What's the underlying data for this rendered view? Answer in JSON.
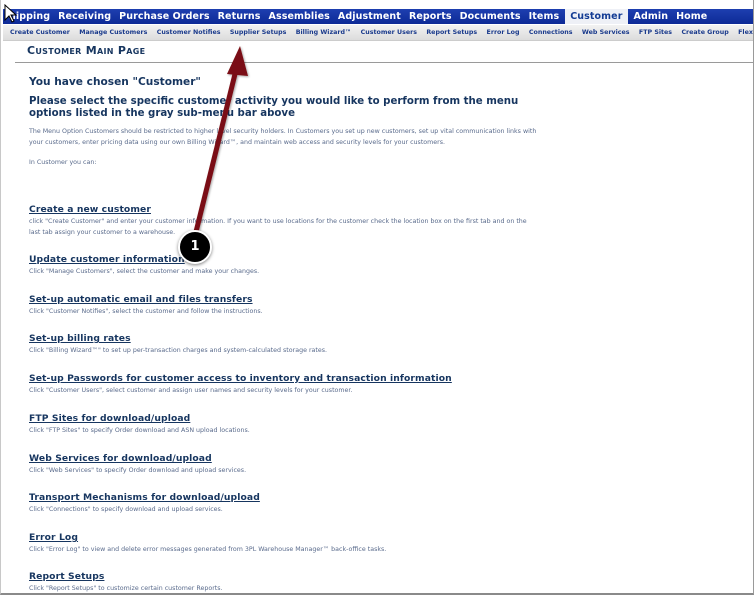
{
  "top_nav": {
    "items": [
      {
        "label": "hipping"
      },
      {
        "label": "Receiving"
      },
      {
        "label": "Purchase Orders"
      },
      {
        "label": "Returns"
      },
      {
        "label": "Assemblies"
      },
      {
        "label": "Adjustment"
      },
      {
        "label": "Reports"
      },
      {
        "label": "Documents"
      },
      {
        "label": "Items"
      },
      {
        "label": "Customer",
        "active": true
      },
      {
        "label": "Admin"
      },
      {
        "label": "Home"
      }
    ]
  },
  "sub_nav": {
    "items": [
      {
        "label": "Create Customer"
      },
      {
        "label": "Manage Customers"
      },
      {
        "label": "Customer Notifies"
      },
      {
        "label": "Supplier Setups"
      },
      {
        "label": "Billing Wizard™"
      },
      {
        "label": "Customer Users"
      },
      {
        "label": "Report Setups"
      },
      {
        "label": "Error Log"
      },
      {
        "label": "Connections"
      },
      {
        "label": "Web Services"
      },
      {
        "label": "FTP Sites"
      },
      {
        "label": "Create Group"
      },
      {
        "label": "Flex Fields"
      }
    ]
  },
  "page": {
    "title": "Customer Main Page",
    "chosen_heading": "You have chosen \"Customer\"",
    "select_heading": "Please select the specific customer activity you would like to perform from the menu options listed in the gray sub-menu bar above",
    "intro": "The Menu Option Customers should be restricted to higher level security holders. In Customers you set up new customers, set up vital communication links with your customers, enter pricing data using our own Billing Wizard™, and maintain web access and security levels for your customers.",
    "can_label": "In Customer you can:"
  },
  "sections": [
    {
      "link": "Create a new customer",
      "desc": "click \"Create Customer\" and enter your customer information. If you want to use locations for the customer check the location box on the first tab and on the last tab assign your customer to a warehouse."
    },
    {
      "link": "Update customer information",
      "desc": "Click \"Manage Customers\", select the customer and make your changes."
    },
    {
      "link": "Set-up automatic email and files transfers",
      "desc": "Click \"Customer Notifies\", select the customer and follow the instructions."
    },
    {
      "link": "Set-up billing rates",
      "desc": "Click \"Billing Wizard™\" to set up per-transaction charges and system-calculated storage rates."
    },
    {
      "link": "Set-up Passwords for customer access to inventory and transaction information",
      "desc": "Click \"Customer Users\", select customer and assign user names and security levels for your customer."
    },
    {
      "link": "FTP Sites for download/upload",
      "desc": "Click \"FTP Sites\" to specify Order download and ASN upload locations."
    },
    {
      "link": "Web Services for download/upload",
      "desc": "Click \"Web Services\" to specify Order download and upload services."
    },
    {
      "link": "Transport Mechanisms for download/upload",
      "desc": "Click \"Connections\" to specify download and upload services."
    },
    {
      "link": "Error Log",
      "desc": "Click \"Error Log\" to view and delete error messages generated from 3PL Warehouse Manager™ back-office tasks."
    },
    {
      "link": "Report Setups",
      "desc": "Click \"Report Setups\" to customize certain customer Reports."
    }
  ],
  "annotation": {
    "step_number": "1",
    "arrow_color": "#7a0d12",
    "target": "Supplier Setups"
  },
  "colors": {
    "nav_blue": "#0d2a96",
    "heading_navy": "#16355f",
    "body_text": "#5a6b8c"
  }
}
